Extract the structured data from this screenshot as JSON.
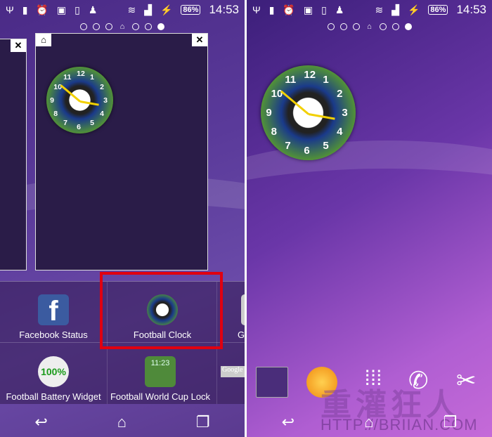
{
  "status": {
    "battery": "86%",
    "time": "14:53",
    "icons": [
      "usb-icon",
      "screenshot-icon",
      "alarm-icon",
      "image-icon",
      "phone-icon",
      "android-icon",
      "wifi-icon",
      "signal-icon",
      "charging-icon"
    ]
  },
  "pages": {
    "count": 7,
    "home_index": 3,
    "active_index": 6
  },
  "left": {
    "widgets": [
      {
        "label": "Facebook Status",
        "icon": "facebook-icon"
      },
      {
        "label": "Football Clock",
        "icon": "football-clock-icon",
        "selected": true
      },
      {
        "label": "G",
        "icon": "partial-icon"
      },
      {
        "label": "Football Battery Widget",
        "icon": "football-battery-icon",
        "badge": "100%"
      },
      {
        "label": "Football World Cup Lock",
        "icon": "world-cup-lock-icon",
        "badge": "11:23"
      },
      {
        "label": "Google",
        "icon": "google-icon"
      }
    ],
    "highlight_color": "#e00010"
  },
  "clock_numbers": [
    "12",
    "1",
    "2",
    "3",
    "4",
    "5",
    "6",
    "7",
    "8",
    "9",
    "10",
    "11"
  ],
  "right": {
    "dock": [
      "folder-icon",
      "gallery-icon",
      "app-drawer-icon",
      "phone-icon",
      "settings-tools-icon"
    ]
  },
  "watermark": {
    "text": "重灌狂人",
    "url": "HTTP://BRIIAN.COM"
  }
}
